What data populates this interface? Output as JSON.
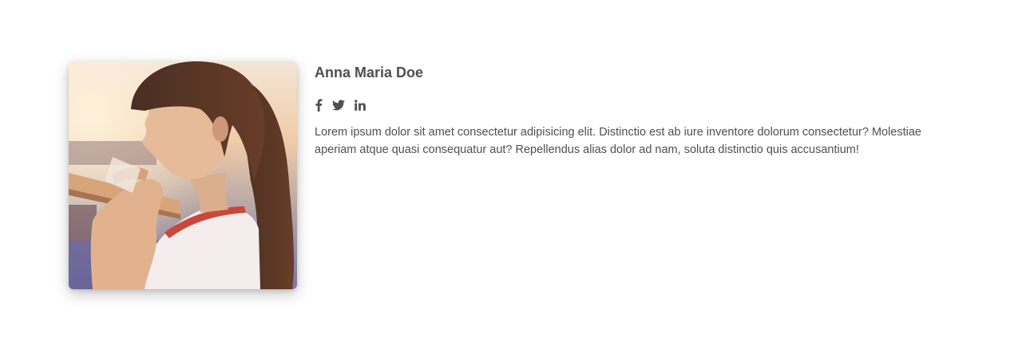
{
  "member": {
    "name": "Anna Maria Doe",
    "bio": "Lorem ipsum dolor sit amet consectetur adipisicing elit. Distinctio est ab iure inventore dolorum consectetur? Molestiae aperiam atque quasi consequatur aut? Repellendus alias dolor ad nam, soluta distinctio quis accusantium!",
    "photo_icon": "portrait-photo"
  },
  "socials": [
    {
      "icon": "facebook-icon"
    },
    {
      "icon": "twitter-icon"
    },
    {
      "icon": "linkedin-icon"
    }
  ],
  "colors": {
    "text": "#4f4f4f",
    "background": "#ffffff"
  }
}
